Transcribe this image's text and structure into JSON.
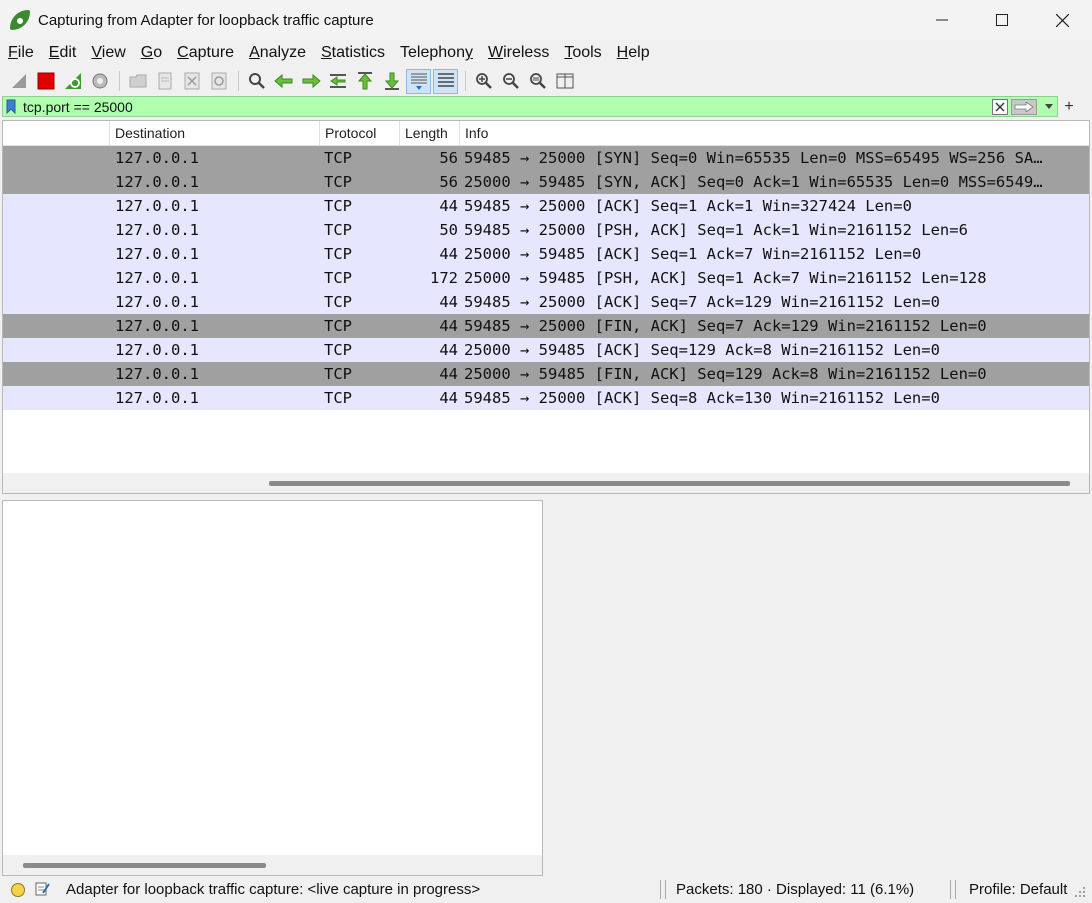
{
  "window": {
    "title": "Capturing from Adapter for loopback traffic capture"
  },
  "menu": [
    {
      "label": "File",
      "accel": "F",
      "rest": "ile"
    },
    {
      "label": "Edit",
      "accel": "E",
      "rest": "dit"
    },
    {
      "label": "View",
      "accel": "V",
      "rest": "iew"
    },
    {
      "label": "Go",
      "accel": "G",
      "rest": "o"
    },
    {
      "label": "Capture",
      "accel": "C",
      "rest": "apture"
    },
    {
      "label": "Analyze",
      "accel": "A",
      "rest": "nalyze"
    },
    {
      "label": "Statistics",
      "accel": "S",
      "rest": "tatistics"
    },
    {
      "label": "Telephony",
      "accel": "T",
      "rest": "elephony",
      "pre": "Telephon",
      "accel2": "y"
    },
    {
      "label": "Wireless",
      "accel": "W",
      "rest": "ireless"
    },
    {
      "label": "Tools",
      "accel": "T",
      "rest": "ools"
    },
    {
      "label": "Help",
      "accel": "H",
      "rest": "elp"
    }
  ],
  "filter": {
    "value": "tcp.port == 25000"
  },
  "columns": {
    "destination": "Destination",
    "protocol": "Protocol",
    "length": "Length",
    "info": "Info"
  },
  "packets": [
    {
      "dst": "127.0.0.1",
      "proto": "TCP",
      "len": "56",
      "info": "59485 → 25000 [SYN] Seq=0 Win=65535 Len=0 MSS=65495 WS=256 SA…",
      "style": "syn"
    },
    {
      "dst": "127.0.0.1",
      "proto": "TCP",
      "len": "56",
      "info": "25000 → 59485 [SYN, ACK] Seq=0 Ack=1 Win=65535 Len=0 MSS=6549…",
      "style": "syn"
    },
    {
      "dst": "127.0.0.1",
      "proto": "TCP",
      "len": "44",
      "info": "59485 → 25000 [ACK] Seq=1 Ack=1 Win=327424 Len=0",
      "style": "tcp"
    },
    {
      "dst": "127.0.0.1",
      "proto": "TCP",
      "len": "50",
      "info": "59485 → 25000 [PSH, ACK] Seq=1 Ack=1 Win=2161152 Len=6",
      "style": "tcp"
    },
    {
      "dst": "127.0.0.1",
      "proto": "TCP",
      "len": "44",
      "info": "25000 → 59485 [ACK] Seq=1 Ack=7 Win=2161152 Len=0",
      "style": "tcp"
    },
    {
      "dst": "127.0.0.1",
      "proto": "TCP",
      "len": "172",
      "info": "25000 → 59485 [PSH, ACK] Seq=1 Ack=7 Win=2161152 Len=128",
      "style": "tcp"
    },
    {
      "dst": "127.0.0.1",
      "proto": "TCP",
      "len": "44",
      "info": "59485 → 25000 [ACK] Seq=7 Ack=129 Win=2161152 Len=0",
      "style": "tcp"
    },
    {
      "dst": "127.0.0.1",
      "proto": "TCP",
      "len": "44",
      "info": "59485 → 25000 [FIN, ACK] Seq=7 Ack=129 Win=2161152 Len=0",
      "style": "syn"
    },
    {
      "dst": "127.0.0.1",
      "proto": "TCP",
      "len": "44",
      "info": "25000 → 59485 [ACK] Seq=129 Ack=8 Win=2161152 Len=0",
      "style": "tcp"
    },
    {
      "dst": "127.0.0.1",
      "proto": "TCP",
      "len": "44",
      "info": "25000 → 59485 [FIN, ACK] Seq=129 Ack=8 Win=2161152 Len=0",
      "style": "syn"
    },
    {
      "dst": "127.0.0.1",
      "proto": "TCP",
      "len": "44",
      "info": "59485 → 25000 [ACK] Seq=8 Ack=130 Win=2161152 Len=0",
      "style": "tcp"
    }
  ],
  "status": {
    "capture_text": "Adapter for loopback traffic capture: <live capture in progress>",
    "packets_text": "Packets: 180 · Displayed: 11 (6.1%)",
    "profile_text": "Profile: Default"
  },
  "colors": {
    "filter_valid_bg": "#afffaf",
    "row_gray": "#a0a0a0",
    "row_tcp": "#e7e6ff",
    "stop_red": "#e00000",
    "shark_green": "#3c8a2e"
  },
  "icons": {
    "toolbar": [
      "start-capture-icon",
      "stop-capture-icon",
      "restart-capture-icon",
      "capture-options-icon",
      "open-file-icon",
      "save-file-icon",
      "close-file-icon",
      "reload-file-icon",
      "find-packet-icon",
      "go-back-icon",
      "go-forward-icon",
      "go-to-packet-icon",
      "go-first-icon",
      "go-last-icon",
      "autoscroll-icon",
      "colorize-icon",
      "zoom-in-icon",
      "zoom-out-icon",
      "zoom-normal-icon",
      "resize-columns-icon"
    ]
  }
}
